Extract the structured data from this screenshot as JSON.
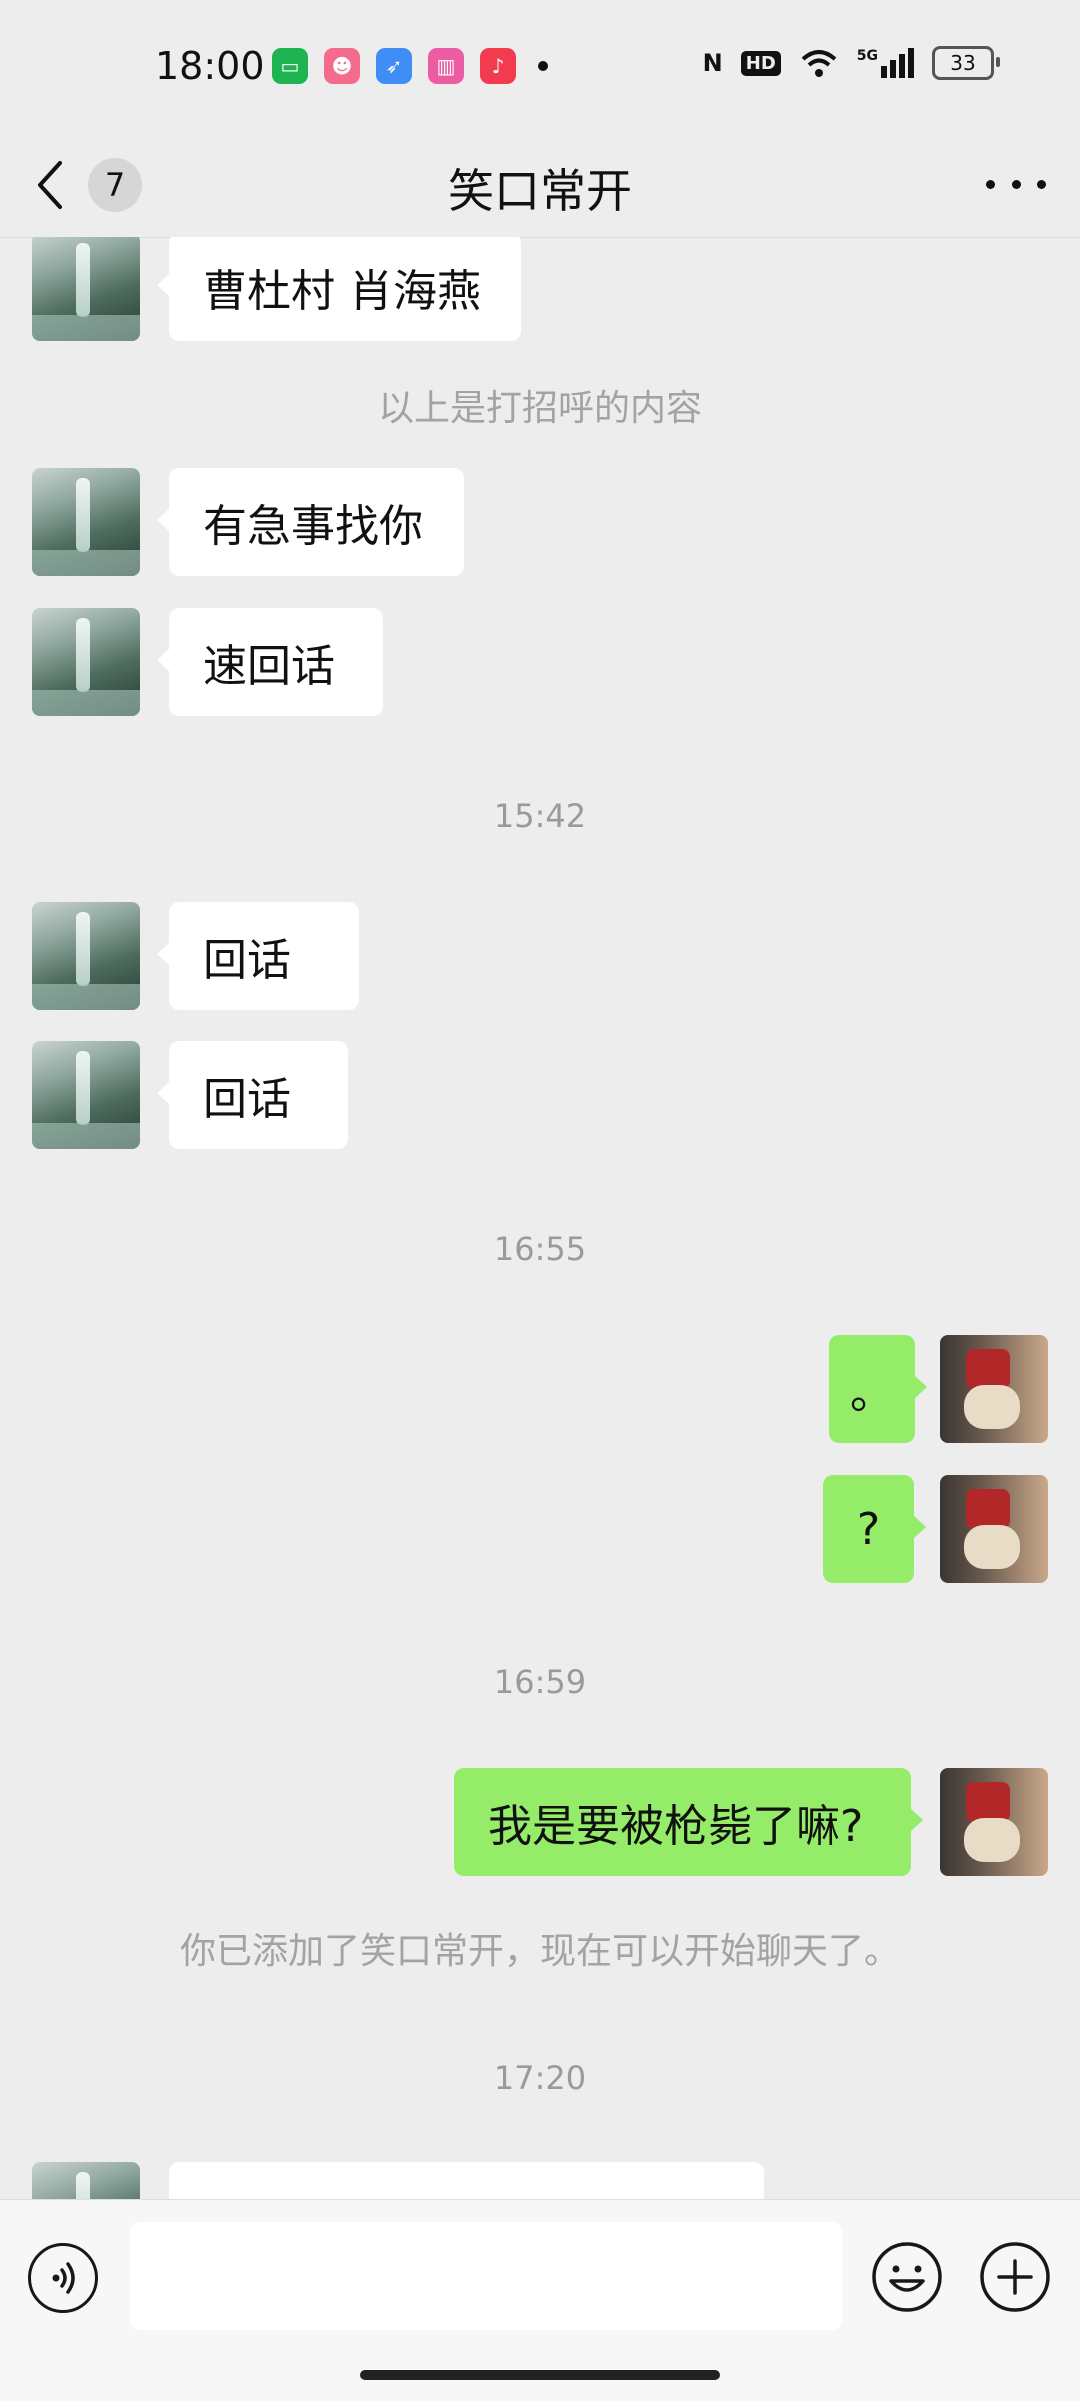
{
  "status_bar": {
    "time": "18:00",
    "app_icons": [
      "messages-icon",
      "face-app-icon",
      "feather-app-icon",
      "bilibili-icon",
      "music-icon"
    ],
    "network": "5G",
    "hd": "HD",
    "battery": "33"
  },
  "header": {
    "back_count": "7",
    "title": "笑口常开"
  },
  "chat": {
    "messages": [
      {
        "type": "left",
        "text": "曹杜村 肖海燕"
      },
      {
        "type": "system",
        "text": "以上是打招呼的内容"
      },
      {
        "type": "left",
        "text": "有急事找你"
      },
      {
        "type": "left",
        "text": "速回话"
      },
      {
        "type": "time",
        "text": "15:42"
      },
      {
        "type": "left",
        "text": " 回话"
      },
      {
        "type": "left",
        "text": "回话"
      },
      {
        "type": "time",
        "text": "16:55"
      },
      {
        "type": "right",
        "text": "。"
      },
      {
        "type": "right",
        "text": "?"
      },
      {
        "type": "time",
        "text": "16:59"
      },
      {
        "type": "right",
        "text": "我是要被枪毙了嘛?"
      },
      {
        "type": "system",
        "text": "你已添加了笑口常开，现在可以开始聊天了。"
      },
      {
        "type": "time",
        "text": "17:20"
      },
      {
        "type": "left",
        "text": ""
      }
    ]
  },
  "input_bar": {
    "value": "",
    "voice_icon": "voice-icon",
    "emoji_icon": "emoji-icon",
    "plus_icon": "plus-icon"
  },
  "colors": {
    "background": "#ededed",
    "bubble_self": "#95ec69",
    "bubble_other": "#ffffff",
    "system_text": "#a3a3a3"
  }
}
